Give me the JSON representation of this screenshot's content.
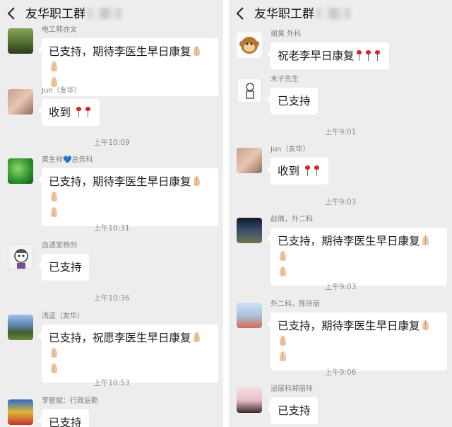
{
  "colors": {
    "bg": "#ededed",
    "bubble": "#ffffff",
    "text": "#1a1a1a",
    "sender": "#7f7f7f",
    "time": "#8a8a8a"
  },
  "screens": [
    {
      "title": "友华职工群",
      "back_icon": "chevron-left-icon",
      "messages": [
        {
          "sender": "电工郭亦文",
          "text": "已支持，期待李医生早日康复",
          "emoji": "folded-hands x3"
        },
        {
          "sender": "Jun（友华）",
          "text": "收到",
          "emoji": "rose x2"
        },
        {
          "time": "上午10:09"
        },
        {
          "sender": "黄生祥💙总务科",
          "text": "已支持，期待李医生早日康复",
          "emoji": "folded-hands x3"
        },
        {
          "time": "上午10:31"
        },
        {
          "sender": "血透室杨剑",
          "text": "已支持"
        },
        {
          "time": "上午10:36"
        },
        {
          "sender": "浅蓝（友华）",
          "text": "已支持，祝愿李医生早日康复",
          "emoji": "folded-hands x3"
        },
        {
          "time": "上午10:53"
        },
        {
          "sender": "李智斌：行政后勤",
          "text": "已支持"
        }
      ]
    },
    {
      "title": "友华职工群",
      "back_icon": "chevron-left-icon",
      "messages": [
        {
          "sender": "谢昊 外科",
          "text": "祝老李早日康复",
          "emoji": "rose x3"
        },
        {
          "sender": "木子先生",
          "text": "已支持"
        },
        {
          "time": "上午9:01"
        },
        {
          "sender": "Jun（友华）",
          "text": "收到",
          "emoji": "rose x2"
        },
        {
          "time": "上午9:03"
        },
        {
          "sender": "赵倩，外二科",
          "text": "已支持，期待李医生早日康复",
          "emoji": "folded-hands x3"
        },
        {
          "time": "上午9:03"
        },
        {
          "sender": "外二科，陈玲丽",
          "text": "已支持，期待李医生早日康复",
          "emoji": "folded-hands x3"
        },
        {
          "time": "上午9:06"
        },
        {
          "sender": "泌尿科郑丽玲",
          "text": "已支持"
        }
      ]
    }
  ]
}
